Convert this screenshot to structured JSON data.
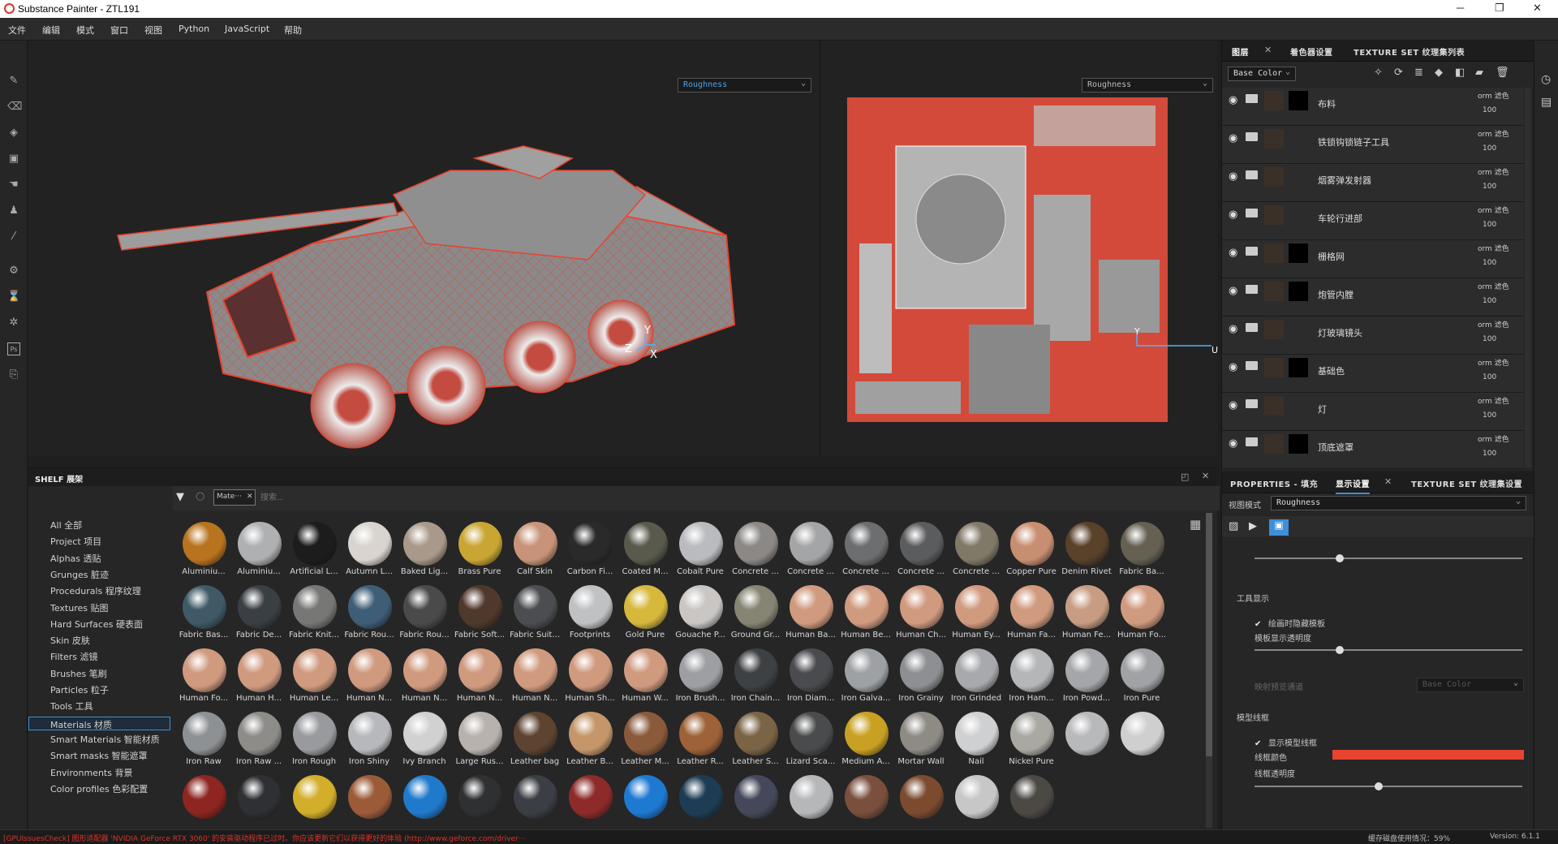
{
  "titlebar": {
    "title": "Substance Painter - ZTL191",
    "minimize": "─",
    "maximize": "❐",
    "close": "✕"
  },
  "menu": [
    "文件",
    "编辑",
    "模式",
    "窗口",
    "视图",
    "Python",
    "JavaScript",
    "帮助"
  ],
  "viewport": {
    "left_channel": "Roughness",
    "right_channel": "Roughness",
    "axis_x": "X",
    "axis_y": "Y",
    "axis_z": "Z",
    "axis_u": "U",
    "axis_v": "Y"
  },
  "layers_panel": {
    "tabs": [
      "图层",
      "着色器设置",
      "TEXTURE SET 纹理集列表"
    ],
    "channel": "Base Color",
    "items": [
      {
        "name": "布料",
        "blend": "orm 滤色",
        "opacity": "100"
      },
      {
        "name": "铁锁钩锁链子工具",
        "blend": "orm 滤色",
        "opacity": "100"
      },
      {
        "name": "烟雾弹发射器",
        "blend": "orm 滤色",
        "opacity": "100"
      },
      {
        "name": "车轮行进部",
        "blend": "orm 滤色",
        "opacity": "100"
      },
      {
        "name": "栅格网",
        "blend": "orm 滤色",
        "opacity": "100"
      },
      {
        "name": "炮管内膛",
        "blend": "orm 滤色",
        "opacity": "100"
      },
      {
        "name": "灯玻璃镜头",
        "blend": "orm 滤色",
        "opacity": "100"
      },
      {
        "name": "基础色",
        "blend": "orm 滤色",
        "opacity": "100"
      },
      {
        "name": "灯",
        "blend": "orm 滤色",
        "opacity": "100"
      },
      {
        "name": "顶底遮罩",
        "blend": "orm 滤色",
        "opacity": "100"
      }
    ]
  },
  "properties": {
    "tabs": [
      "PROPERTIES - 填充",
      "显示设置",
      "TEXTURE SET 纹理集设置"
    ],
    "view_mode_label": "视图模式",
    "view_mode": "Roughness",
    "tool_display": "工具显示",
    "hide_stencil": "绘画时隐藏模板",
    "stencil_opacity": "模板显示透明度",
    "map_preview": "映射预览通道",
    "map_preview_value": "Base Color",
    "wireframe": "模型线框",
    "show_wireframe": "显示模型线框",
    "wire_color_label": "线框颜色",
    "wire_color": "#e8432f",
    "wire_opacity": "线框透明度"
  },
  "shelf": {
    "title": "SHELF 展架",
    "filter_chip": "Mate···",
    "search_placeholder": "搜索...",
    "categories": [
      "All 全部",
      "Project 项目",
      "Alphas 透贴",
      "Grunges 脏迹",
      "Procedurals 程序纹理",
      "Textures 贴图",
      "Hard Surfaces 硬表面",
      "Skin 皮肤",
      "Filters 滤镜",
      "Brushes 笔刷",
      "Particles 粒子",
      "Tools 工具",
      "Materials 材质",
      "Smart Materials 智能材质",
      "Smart masks 智能遮罩",
      "Environments 背景",
      "Color profiles 色彩配置"
    ],
    "selected_category": "Materials 材质",
    "materials": [
      {
        "name": "Aluminiu...",
        "color": "#b8731e"
      },
      {
        "name": "Aluminiu...",
        "color": "#aeb0b2"
      },
      {
        "name": "Artificial L...",
        "color": "#1c1c1c"
      },
      {
        "name": "Autumn L...",
        "color": "#d9d4cf"
      },
      {
        "name": "Baked Lig...",
        "color": "#a8998a"
      },
      {
        "name": "Brass Pure",
        "color": "#c9a633"
      },
      {
        "name": "Calf Skin",
        "color": "#c89378"
      },
      {
        "name": "Carbon Fi...",
        "color": "#2a2a2a"
      },
      {
        "name": "Coated M...",
        "color": "#595a4c"
      },
      {
        "name": "Cobalt Pure",
        "color": "#b9bbbe"
      },
      {
        "name": "Concrete ...",
        "color": "#8b8886"
      },
      {
        "name": "Concrete ...",
        "color": "#a4a5a6"
      },
      {
        "name": "Concrete ...",
        "color": "#6d6e70"
      },
      {
        "name": "Concrete ...",
        "color": "#5b5c5e"
      },
      {
        "name": "Concrete ...",
        "color": "#817968"
      },
      {
        "name": "Copper Pure",
        "color": "#c88e72"
      },
      {
        "name": "Denim Rivet",
        "color": "#59412a"
      },
      {
        "name": "Fabric Ba...",
        "color": "#656052"
      },
      {
        "name": "Fabric Bas...",
        "color": "#3f5a66"
      },
      {
        "name": "Fabric De...",
        "color": "#3a3f44"
      },
      {
        "name": "Fabric Knit...",
        "color": "#777776"
      },
      {
        "name": "Fabric Rou...",
        "color": "#3e5e78"
      },
      {
        "name": "Fabric Rou...",
        "color": "#4a4a4a"
      },
      {
        "name": "Fabric Soft...",
        "color": "#51382c"
      },
      {
        "name": "Fabric Suit...",
        "color": "#4b4d50"
      },
      {
        "name": "Footprints",
        "color": "#bfc1c3"
      },
      {
        "name": "Gold Pure",
        "color": "#d6b83c"
      },
      {
        "name": "Gouache P...",
        "color": "#c9c6c4"
      },
      {
        "name": "Ground Gr...",
        "color": "#868472"
      },
      {
        "name": "Human Ba...",
        "color": "#d09a7f"
      },
      {
        "name": "Human Be...",
        "color": "#d09a7f"
      },
      {
        "name": "Human Ch...",
        "color": "#d09a7f"
      },
      {
        "name": "Human Ey...",
        "color": "#d09a7f"
      },
      {
        "name": "Human Fa...",
        "color": "#d09a7f"
      },
      {
        "name": "Human Fe...",
        "color": "#c79c82"
      },
      {
        "name": "Human Fo...",
        "color": "#d09a7f"
      },
      {
        "name": "Human Fo...",
        "color": "#d09a7f"
      },
      {
        "name": "Human H...",
        "color": "#d09a7f"
      },
      {
        "name": "Human Le...",
        "color": "#d09a7f"
      },
      {
        "name": "Human N...",
        "color": "#d09a7f"
      },
      {
        "name": "Human N...",
        "color": "#d09a7f"
      },
      {
        "name": "Human N...",
        "color": "#d09a7f"
      },
      {
        "name": "Human N...",
        "color": "#d09a7f"
      },
      {
        "name": "Human Sh...",
        "color": "#d09a7f"
      },
      {
        "name": "Human W...",
        "color": "#d09a7f"
      },
      {
        "name": "Iron Brush...",
        "color": "#9d9fa2"
      },
      {
        "name": "Iron Chain...",
        "color": "#3e4144"
      },
      {
        "name": "Iron Diam...",
        "color": "#4a4b4e"
      },
      {
        "name": "Iron Galva...",
        "color": "#9ea1a4"
      },
      {
        "name": "Iron Grainy",
        "color": "#8d8f92"
      },
      {
        "name": "Iron Grinded",
        "color": "#a7a9ac"
      },
      {
        "name": "Iron Ham...",
        "color": "#b5b6b8"
      },
      {
        "name": "Iron Powd...",
        "color": "#a4a6a9"
      },
      {
        "name": "Iron Pure",
        "color": "#a0a2a5"
      },
      {
        "name": "Iron Raw",
        "color": "#8e9194"
      },
      {
        "name": "Iron Raw ...",
        "color": "#8d8c89"
      },
      {
        "name": "Iron Rough",
        "color": "#989a9d"
      },
      {
        "name": "Iron Shiny",
        "color": "#b6b8bb"
      },
      {
        "name": "Ivy Branch",
        "color": "#d1d1d1"
      },
      {
        "name": "Large Rus...",
        "color": "#b9b1ab"
      },
      {
        "name": "Leather bag",
        "color": "#5d4330"
      },
      {
        "name": "Leather B...",
        "color": "#c4966a"
      },
      {
        "name": "Leather M...",
        "color": "#8a5a3b"
      },
      {
        "name": "Leather R...",
        "color": "#9d6237"
      },
      {
        "name": "Leather S...",
        "color": "#7a6445"
      },
      {
        "name": "Lizard Sca...",
        "color": "#4a4b4c"
      },
      {
        "name": "Medium A...",
        "color": "#c9a122"
      },
      {
        "name": "Mortar Wall",
        "color": "#8e8a84"
      },
      {
        "name": "Nail",
        "color": "#cfd0d1"
      },
      {
        "name": "Nickel Pure",
        "color": "#a9a8a2"
      },
      {
        "name": "",
        "color": "#b8b9bb"
      },
      {
        "name": "",
        "color": "#cfcfcf"
      },
      {
        "name": "",
        "color": "#8d2520"
      },
      {
        "name": "",
        "color": "#2e3033"
      },
      {
        "name": "",
        "color": "#d2ae2a"
      },
      {
        "name": "",
        "color": "#9c5b38"
      },
      {
        "name": "",
        "color": "#1f7acb"
      },
      {
        "name": "",
        "color": "#2f3032"
      },
      {
        "name": "",
        "color": "#3b3e44"
      },
      {
        "name": "",
        "color": "#8e2a2a"
      },
      {
        "name": "",
        "color": "#1e79d1"
      },
      {
        "name": "",
        "color": "#1e3d54"
      },
      {
        "name": "",
        "color": "#44485a"
      },
      {
        "name": "",
        "color": "#b6b7b9"
      },
      {
        "name": "",
        "color": "#7a4f3e"
      },
      {
        "name": "",
        "color": "#7b4a2f"
      },
      {
        "name": "",
        "color": "#c7c7c7"
      },
      {
        "name": "",
        "color": "#4c4844"
      }
    ]
  },
  "status": {
    "message": "[GPUIssuesCheck] 图形适配器 'NVIDIA GeForce RTX 3060' 的安装驱动程序已过时。你应该更新它们以获得更好的体验 (http://www.geforce.com/driver···",
    "cache": "缓存磁盘使用情况：59%",
    "version": "Version: 6.1.1"
  }
}
